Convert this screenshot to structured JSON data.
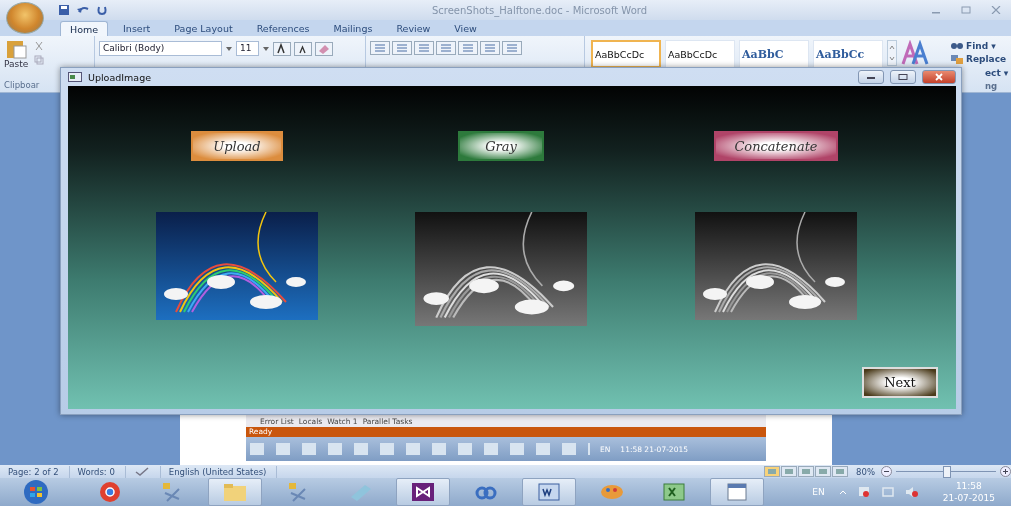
{
  "word": {
    "title": "ScreenShots_Halftone.doc - Microsoft Word",
    "ribbon_tabs": [
      {
        "label": "Home",
        "selected": true
      },
      {
        "label": "Insert",
        "selected": false
      },
      {
        "label": "Page Layout",
        "selected": false
      },
      {
        "label": "References",
        "selected": false
      },
      {
        "label": "Mailings",
        "selected": false
      },
      {
        "label": "Review",
        "selected": false
      },
      {
        "label": "View",
        "selected": false
      }
    ],
    "clipboard": {
      "paste": "Paste",
      "group": "Clipboar"
    },
    "font": {
      "name": "Calibri (Body)",
      "size": "11"
    },
    "styles": [
      {
        "sample": "AaBbCcDc",
        "kind": "plain",
        "selected": true
      },
      {
        "sample": "AaBbCcDc",
        "kind": "plain",
        "selected": false
      },
      {
        "sample": "AaBbC",
        "kind": "heading",
        "selected": false
      },
      {
        "sample": "AaBbCc",
        "kind": "heading",
        "selected": false
      }
    ],
    "editing": {
      "find": "Find ▾",
      "replace": "Replace",
      "select": "ect ▾",
      "group": "ng"
    }
  },
  "upload_window": {
    "title": "UploadImage",
    "buttons": [
      {
        "label": "Upload",
        "color": "#dc8d3e"
      },
      {
        "label": "Gray",
        "color": "#2d7a3c"
      },
      {
        "label": "Concatenate",
        "color": "#b04468"
      }
    ],
    "images": [
      {
        "kind": "color"
      },
      {
        "kind": "gray"
      },
      {
        "kind": "gray"
      }
    ],
    "next": "Next"
  },
  "embedded_screenshot": {
    "tabs": [
      "Error List",
      "Locals",
      "Watch 1",
      "Parallel Tasks"
    ],
    "status": "Ready",
    "lang": "EN",
    "time": "11:58",
    "date": "21-07-2015"
  },
  "status_bar": {
    "page": "Page: 2 of 2",
    "words": "Words: 0",
    "language": "English (United States)",
    "zoom": "80%",
    "zoom_slider": {
      "level": 0.5
    }
  },
  "taskbar": {
    "lang": "EN",
    "time": "11:58",
    "date": "21-07-2015"
  }
}
